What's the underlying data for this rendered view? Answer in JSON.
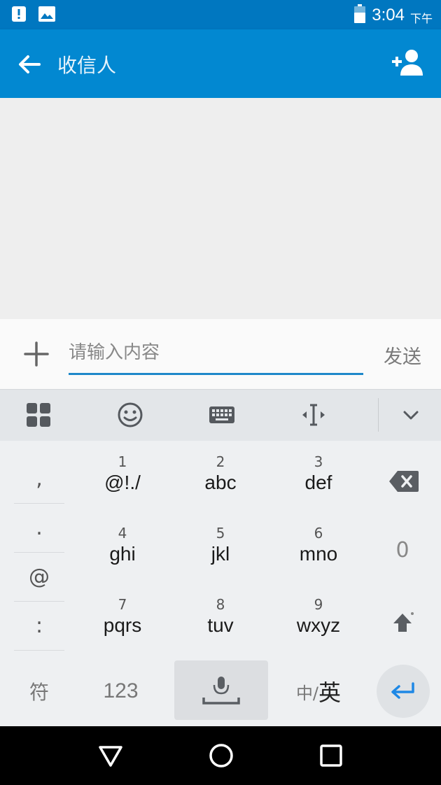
{
  "status_bar": {
    "time": "3:04",
    "ampm": "下午",
    "icons": [
      "alert-icon",
      "image-icon",
      "battery-icon"
    ]
  },
  "app_bar": {
    "title": "收信人",
    "icons": [
      "back-arrow-icon",
      "add-contact-icon"
    ]
  },
  "compose": {
    "placeholder": "请输入内容",
    "value": "",
    "send_label": "发送"
  },
  "keyboard_toolbar": {
    "icons": [
      "apps-grid-icon",
      "emoji-icon",
      "keyboard-icon",
      "cursor-move-icon",
      "collapse-chevron-icon"
    ]
  },
  "keyboard": {
    "symbols": [
      ",",
      ".",
      "@",
      ":"
    ],
    "keys": [
      {
        "num": "1",
        "letters": "@!./"
      },
      {
        "num": "2",
        "letters": "abc"
      },
      {
        "num": "3",
        "letters": "def"
      },
      {
        "num": "4",
        "letters": "ghi"
      },
      {
        "num": "5",
        "letters": "jkl"
      },
      {
        "num": "6",
        "letters": "mno"
      },
      {
        "num": "7",
        "letters": "pqrs"
      },
      {
        "num": "8",
        "letters": "tuv"
      },
      {
        "num": "9",
        "letters": "wxyz"
      }
    ],
    "zero": "0",
    "fu": "符",
    "num_mode": "123",
    "lang_zh": "中/",
    "lang_en": "英"
  },
  "colors": {
    "status_bar": "#0077c0",
    "app_bar": "#0288d1",
    "accent": "#1e88c9",
    "keyboard_bg": "#eef0f2"
  }
}
